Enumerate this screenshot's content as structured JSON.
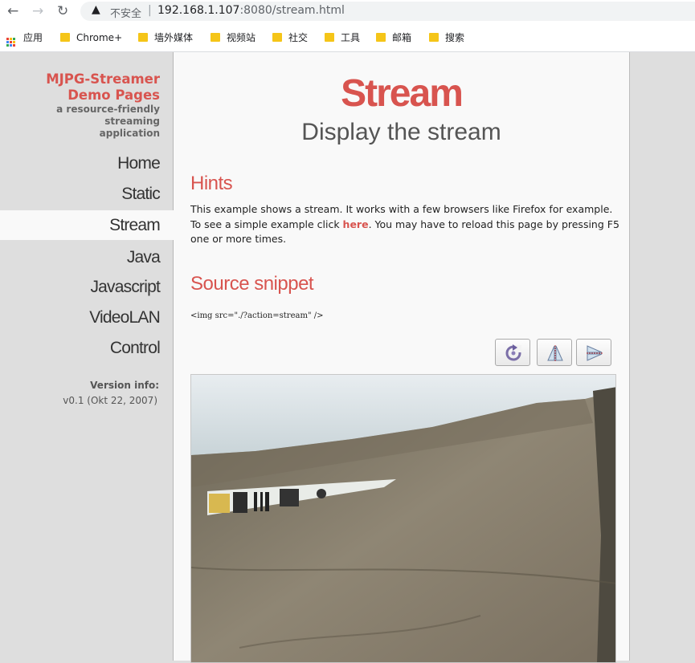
{
  "browser": {
    "security_label": "不安全",
    "separator": "|",
    "url_host": "192.168.1.107",
    "url_rest": ":8080/stream.html",
    "icons": [
      "back-icon",
      "forward-icon",
      "reload-icon",
      "warning-icon",
      "apps-icon",
      "folder-icon"
    ]
  },
  "bookmarks": [
    {
      "label": "应用"
    },
    {
      "label": "Chrome+"
    },
    {
      "label": "墙外媒体"
    },
    {
      "label": "视频站"
    },
    {
      "label": "社交"
    },
    {
      "label": "工具"
    },
    {
      "label": "邮箱"
    },
    {
      "label": "搜索"
    }
  ],
  "sidebar": {
    "brand_line1": "MJPG-Streamer",
    "brand_line2": "Demo Pages",
    "brand_sub1": "a resource-friendly streaming",
    "brand_sub2": "application",
    "menu": [
      {
        "label": "Home",
        "active": false
      },
      {
        "label": "Static",
        "active": false
      },
      {
        "label": "Stream",
        "active": true
      },
      {
        "label": "Java",
        "active": false
      },
      {
        "label": "Javascript",
        "active": false
      },
      {
        "label": "VideoLAN",
        "active": false
      },
      {
        "label": "Control",
        "active": false
      }
    ],
    "version_label": "Version info:",
    "version_value": "v0.1 (Okt 22, 2007)"
  },
  "main": {
    "title": "Stream",
    "subtitle": "Display the stream",
    "hints_heading": "Hints",
    "hints_text_1": "This example shows a stream. It works with a few browsers like Firefox for example. To see a simple example click ",
    "hints_link": "here",
    "hints_text_2": ". You may have to reload this page by pressing F5 one or more times.",
    "snippet_heading": "Source snippet",
    "snippet_code": "<img src=\"./?action=stream\" />",
    "controls": [
      "rotate-icon",
      "flip-vertical-icon",
      "flip-horizontal-icon"
    ]
  },
  "colors": {
    "accent": "#d8544f",
    "sidebar_bg": "#dedede",
    "content_bg": "#f9f9f9"
  }
}
